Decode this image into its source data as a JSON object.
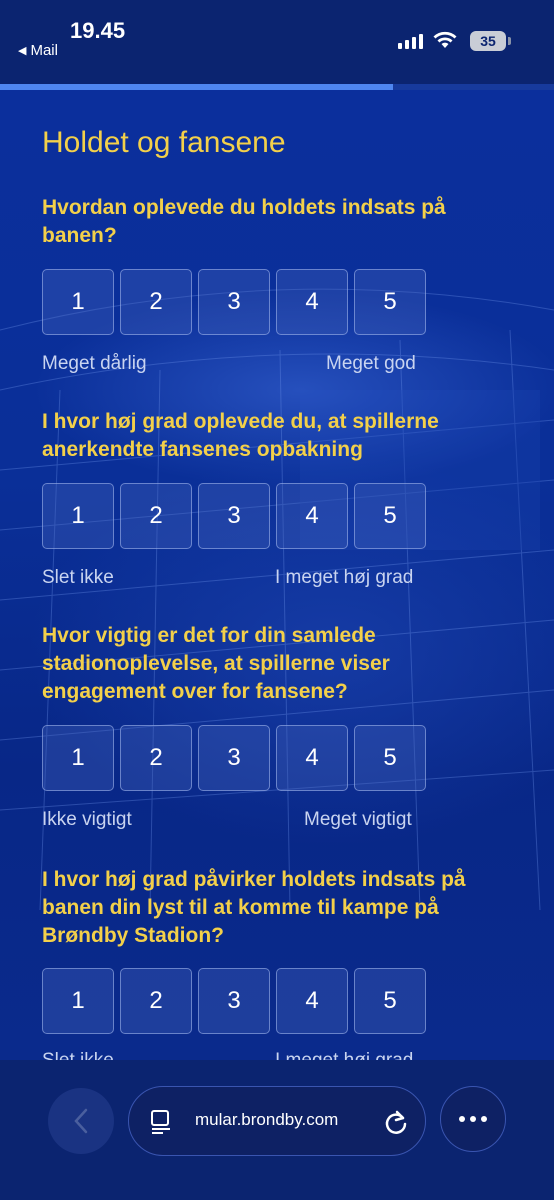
{
  "status_bar": {
    "time": "19.45",
    "back_app": "Mail",
    "battery": "35"
  },
  "progress": {
    "fraction": 0.71
  },
  "page": {
    "title": "Holdet og fansene",
    "scale_values": [
      "1",
      "2",
      "3",
      "4",
      "5"
    ],
    "questions": [
      {
        "text": "Hvordan oplevede du holdets indsats på banen?",
        "low_label": "Meget dårlig",
        "high_label": "Meget god"
      },
      {
        "text": "I hvor høj grad oplevede du, at spillerne anerkendte fansenes opbakning",
        "low_label": "Slet ikke",
        "high_label": "I meget høj grad"
      },
      {
        "text": "Hvor vigtig er det for din samlede stadionoplevelse, at spillerne viser engagement over for fansene?",
        "low_label": "Ikke vigtigt",
        "high_label": "Meget vigtigt"
      },
      {
        "text": "I hvor høj grad påvirker holdets indsats på banen din lyst til at komme til kampe på Brøndby Stadion?",
        "low_label": "Slet ikke",
        "high_label": "I meget høj grad"
      }
    ]
  },
  "browser": {
    "url": "mular.brondby.com"
  },
  "icons": {
    "back": "chevron-left-icon",
    "tabs": "page-icon",
    "reload": "reload-icon",
    "more": "more-dots-icon"
  }
}
